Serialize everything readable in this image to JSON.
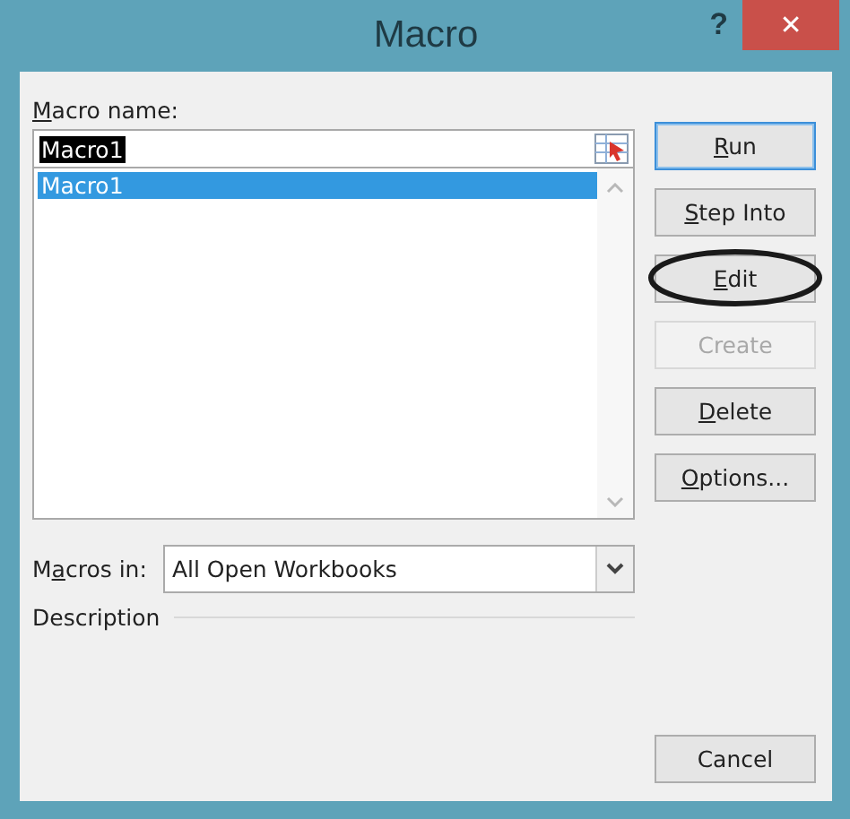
{
  "window": {
    "title": "Macro",
    "help": "?",
    "close": "✕"
  },
  "macro_name": {
    "label": {
      "key": "M",
      "after": "acro name:"
    },
    "value": "Macro1"
  },
  "macro_list": {
    "items": [
      {
        "text": "Macro1",
        "selected": true
      }
    ]
  },
  "macros_in": {
    "label": {
      "before": "M",
      "key": "a",
      "after": "cros in:"
    },
    "value": "All Open Workbooks"
  },
  "description": {
    "label": "Description"
  },
  "buttons": [
    {
      "label": {
        "key": "R",
        "after": "un"
      },
      "disabled": false,
      "focused": true,
      "circled": false
    },
    {
      "label": {
        "key": "S",
        "after": "tep Into"
      },
      "disabled": false,
      "focused": false,
      "circled": false
    },
    {
      "label": {
        "key": "E",
        "after": "dit"
      },
      "disabled": false,
      "focused": false,
      "circled": true
    },
    {
      "label": {
        "after": "Create"
      },
      "disabled": true,
      "focused": false,
      "circled": false
    },
    {
      "label": {
        "key": "D",
        "after": "elete"
      },
      "disabled": false,
      "focused": false,
      "circled": false
    },
    {
      "label": {
        "key": "O",
        "after": "ptions..."
      },
      "disabled": false,
      "focused": false,
      "circled": false
    }
  ],
  "cancel_button": "Cancel"
}
